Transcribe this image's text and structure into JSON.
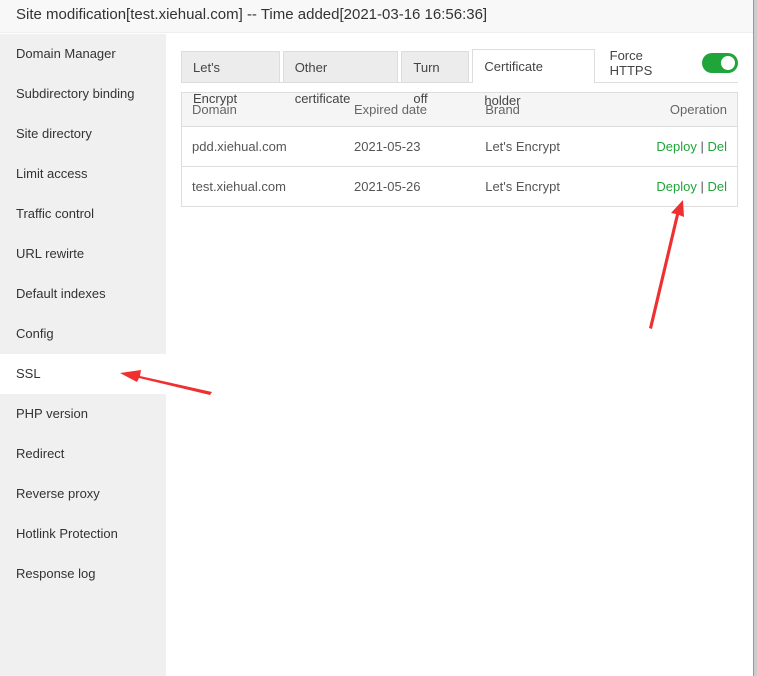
{
  "title": "Site modification[test.xiehual.com] -- Time added[2021-03-16 16:56:36]",
  "sidebar": [
    "Domain Manager",
    "Subdirectory binding",
    "Site directory",
    "Limit access",
    "Traffic control",
    "URL rewirte",
    "Default indexes",
    "Config",
    "SSL",
    "PHP version",
    "Redirect",
    "Reverse proxy",
    "Hotlink Protection",
    "Response log"
  ],
  "tabs": [
    "Let's Encrypt",
    "Other certificate",
    "Turn off",
    "Certificate holder"
  ],
  "force_https": {
    "label": "Force HTTPS",
    "on": true
  },
  "table": {
    "headers": [
      "Domain",
      "Expired date",
      "Brand",
      "Operation"
    ],
    "rows": [
      {
        "domain": "pdd.xiehual.com",
        "expired": "2021-05-23",
        "brand": "Let's Encrypt",
        "deploy": "Deploy",
        "sep": "|",
        "del": "Del"
      },
      {
        "domain": "test.xiehual.com",
        "expired": "2021-05-26",
        "brand": "Let's Encrypt",
        "deploy": "Deploy",
        "sep": "|",
        "del": "Del"
      }
    ]
  },
  "colors": {
    "accent": "#20a53a",
    "arrow": "#f03030"
  }
}
